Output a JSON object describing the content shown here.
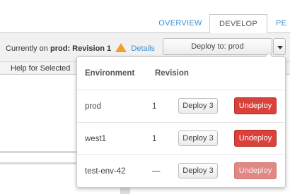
{
  "tabs": [
    {
      "label": "OVERVIEW"
    },
    {
      "label": "DEVELOP"
    },
    {
      "label": "PE"
    }
  ],
  "toolbar": {
    "status_prefix": "Currently on ",
    "env": "prod",
    "revision_text": ": Revision 1",
    "details_link": "Details",
    "deploy_select_value": "Deploy to: prod"
  },
  "panel": {
    "title": "Help for Selected"
  },
  "popup": {
    "columns": {
      "environment": "Environment",
      "revision": "Revision"
    },
    "rows": [
      {
        "environment": "prod",
        "revision": "1",
        "deploy_label": "Deploy 3",
        "undeploy_label": "Undeploy",
        "undeploy_enabled": true
      },
      {
        "environment": "west1",
        "revision": "1",
        "deploy_label": "Deploy 3",
        "undeploy_label": "Undeploy",
        "undeploy_enabled": true
      },
      {
        "environment": "test-env-42",
        "revision": "—",
        "deploy_label": "Deploy 3",
        "undeploy_label": "Undeploy",
        "undeploy_enabled": false
      }
    ]
  },
  "colors": {
    "link": "#3a8fd6",
    "warning": "#f0a030",
    "danger": "#d9413a"
  }
}
